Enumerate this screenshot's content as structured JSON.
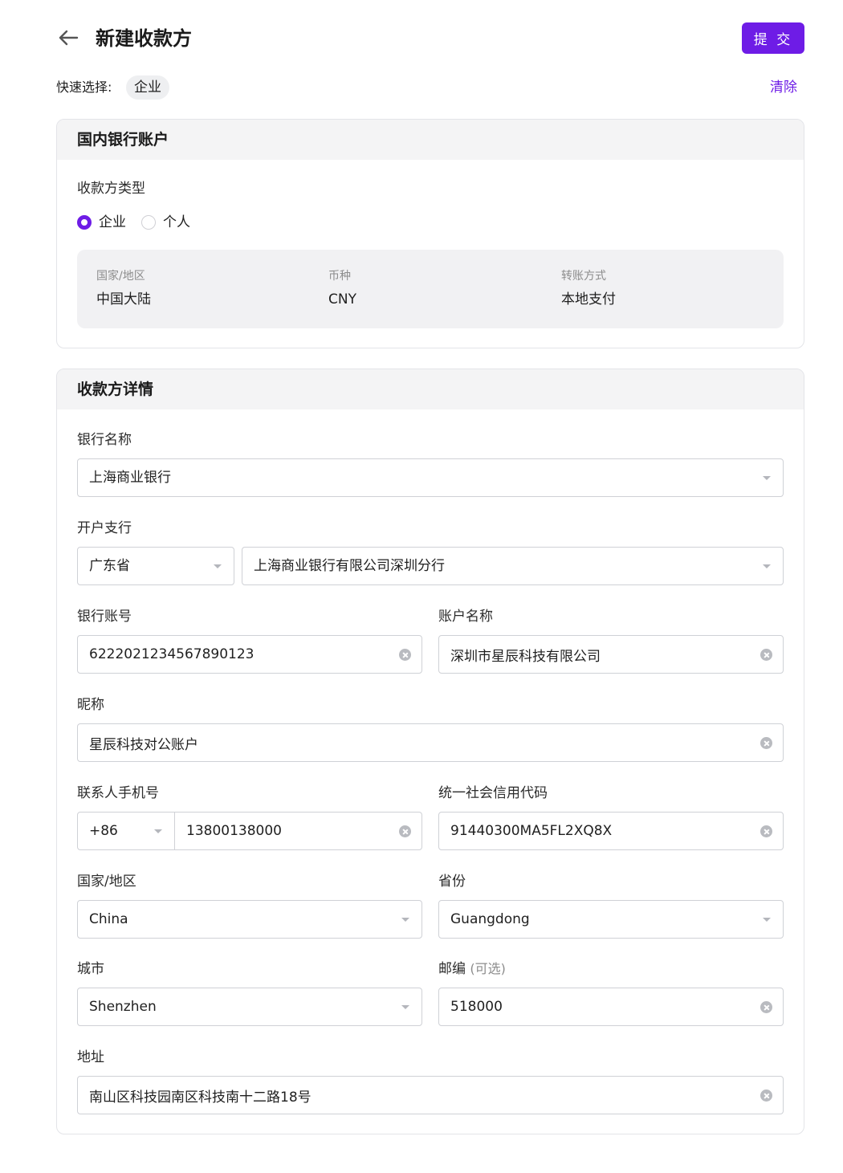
{
  "header": {
    "title": "新建收款方",
    "submit_label": "提 交"
  },
  "quick_select": {
    "label": "快速选择:",
    "chip": "企业",
    "clear_label": "清除"
  },
  "bank_account": {
    "title": "国内银行账户",
    "type_label": "收款方类型",
    "options": [
      {
        "label": "企业",
        "checked": true
      },
      {
        "label": "个人",
        "checked": false
      }
    ],
    "info": [
      {
        "key": "国家/地区",
        "value": "中国大陆"
      },
      {
        "key": "币种",
        "value": "CNY"
      },
      {
        "key": "转账方式",
        "value": "本地支付"
      }
    ]
  },
  "details": {
    "title": "收款方详情",
    "bank_name": {
      "label": "银行名称",
      "value": "上海商业银行"
    },
    "branch": {
      "label": "开户支行",
      "province": "广东省",
      "branch": "上海商业银行有限公司深圳分行"
    },
    "account_no": {
      "label": "银行账号",
      "value": "6222021234567890123"
    },
    "account_name": {
      "label": "账户名称",
      "value": "深圳市星辰科技有限公司"
    },
    "nickname": {
      "label": "昵称",
      "value": "星辰科技对公账户"
    },
    "phone": {
      "label": "联系人手机号",
      "code": "+86",
      "value": "13800138000"
    },
    "credit_code": {
      "label": "统一社会信用代码",
      "value": "91440300MA5FL2XQ8X"
    },
    "country": {
      "label": "国家/地区",
      "value": "China"
    },
    "province": {
      "label": "省份",
      "value": "Guangdong"
    },
    "city": {
      "label": "城市",
      "value": "Shenzhen"
    },
    "postal": {
      "label": "邮编",
      "optional": "(可选)",
      "value": "518000"
    },
    "address": {
      "label": "地址",
      "value": "南山区科技园南区科技南十二路18号"
    }
  }
}
